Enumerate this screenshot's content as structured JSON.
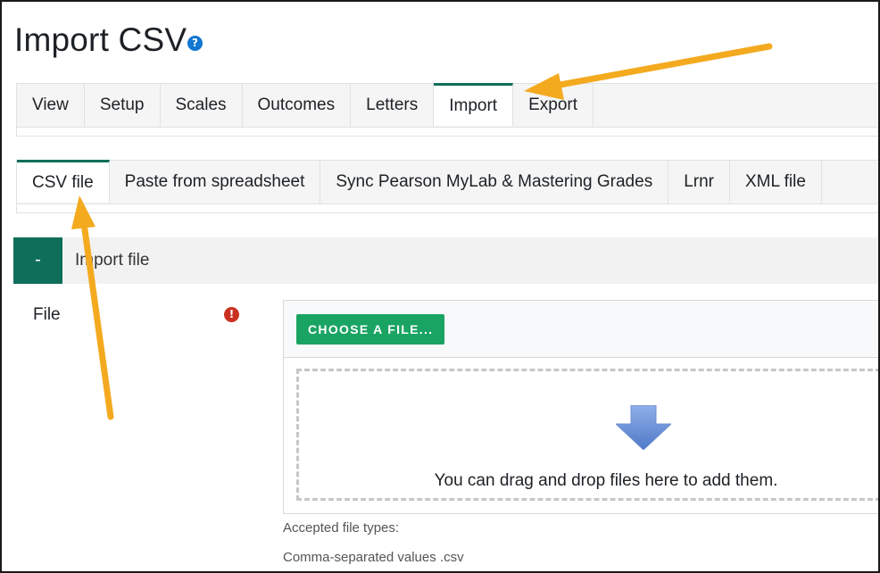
{
  "page": {
    "title": "Import CSV"
  },
  "help_icon": {
    "glyph": "?"
  },
  "main_tabs": [
    {
      "label": "View"
    },
    {
      "label": "Setup"
    },
    {
      "label": "Scales"
    },
    {
      "label": "Outcomes"
    },
    {
      "label": "Letters"
    },
    {
      "label": "Import",
      "active": true
    },
    {
      "label": "Export"
    }
  ],
  "import_tabs": [
    {
      "label": "CSV file",
      "active": true
    },
    {
      "label": "Paste from spreadsheet"
    },
    {
      "label": "Sync Pearson MyLab & Mastering Grades"
    },
    {
      "label": "Lrnr"
    },
    {
      "label": "XML file"
    }
  ],
  "section": {
    "collapse_glyph": "-",
    "title": "Import file"
  },
  "file_field": {
    "label": "File",
    "required_glyph": "!",
    "choose_button": "CHOOSE A FILE...",
    "drop_text": "You can drag and drop files here to add them.",
    "accepted_label": "Accepted file types:",
    "accepted_type": "Comma-separated values .csv"
  },
  "colors": {
    "accent": "#0f6e5a",
    "button": "#1aa463",
    "help": "#1177d1",
    "required": "#ca3120",
    "annotation_arrow": "#f4aa1f"
  }
}
